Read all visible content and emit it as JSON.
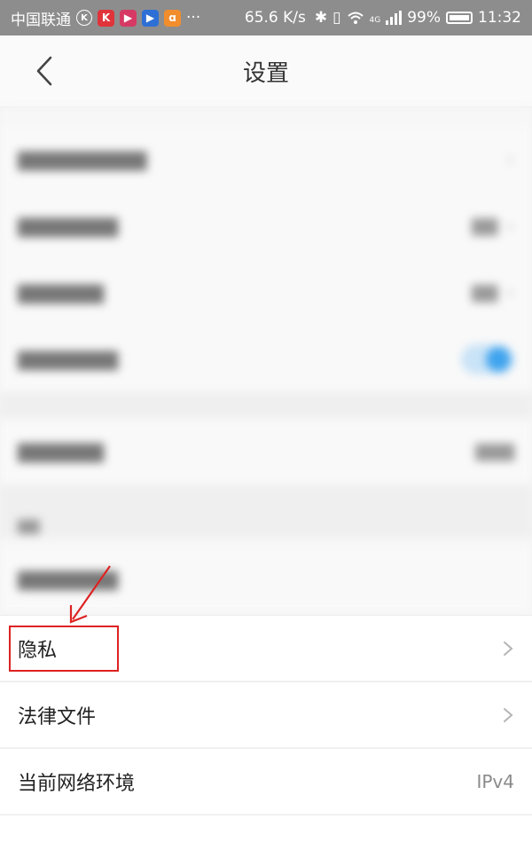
{
  "status_bar": {
    "carrier": "中国联通",
    "speed": "65.6 K/s",
    "network": "4G",
    "battery": "99%",
    "time": "11:32",
    "more": "···"
  },
  "header": {
    "title": "设置",
    "back_icon": "chevron-left-icon"
  },
  "rows": [
    {
      "label": "隐私",
      "chevron": true
    },
    {
      "label": "法律文件",
      "chevron": true
    },
    {
      "label": "当前网络环境",
      "value": "IPv4"
    }
  ],
  "colors": {
    "highlight": "#dd2222",
    "accent": "#3fa3ee"
  }
}
